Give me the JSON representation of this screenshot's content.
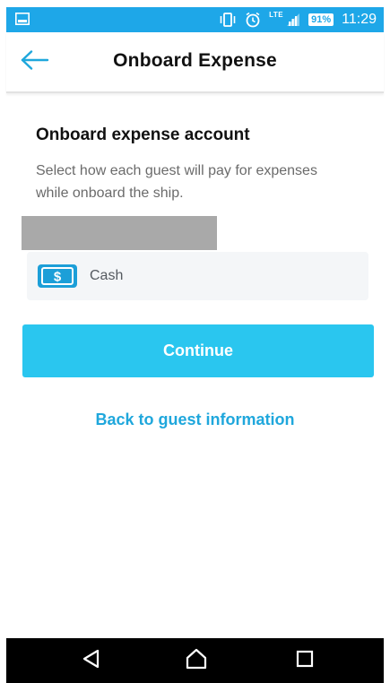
{
  "status_bar": {
    "battery": "91%",
    "time": "11:29",
    "network": "LTE",
    "icons": [
      "image-icon",
      "vibrate-icon",
      "alarm-icon",
      "signal-icon",
      "battery-icon"
    ]
  },
  "header": {
    "title": "Onboard Expense",
    "back_icon": "back-arrow-icon"
  },
  "main": {
    "heading": "Onboard expense account",
    "description": "Select how each guest will pay for expenses while onboard the ship.",
    "payment_option": {
      "label": "Cash",
      "icon": "cash-icon"
    },
    "continue_label": "Continue",
    "back_link": "Back to guest information"
  },
  "nav_bar": {
    "icons": [
      "nav-back-icon",
      "nav-home-icon",
      "nav-recents-icon"
    ]
  },
  "colors": {
    "status_bar": "#1ea7e8",
    "accent": "#2ac6ef",
    "link": "#1fa7dc",
    "back_arrow": "#1fa7dc",
    "cash_icon": "#1c9fd8"
  }
}
